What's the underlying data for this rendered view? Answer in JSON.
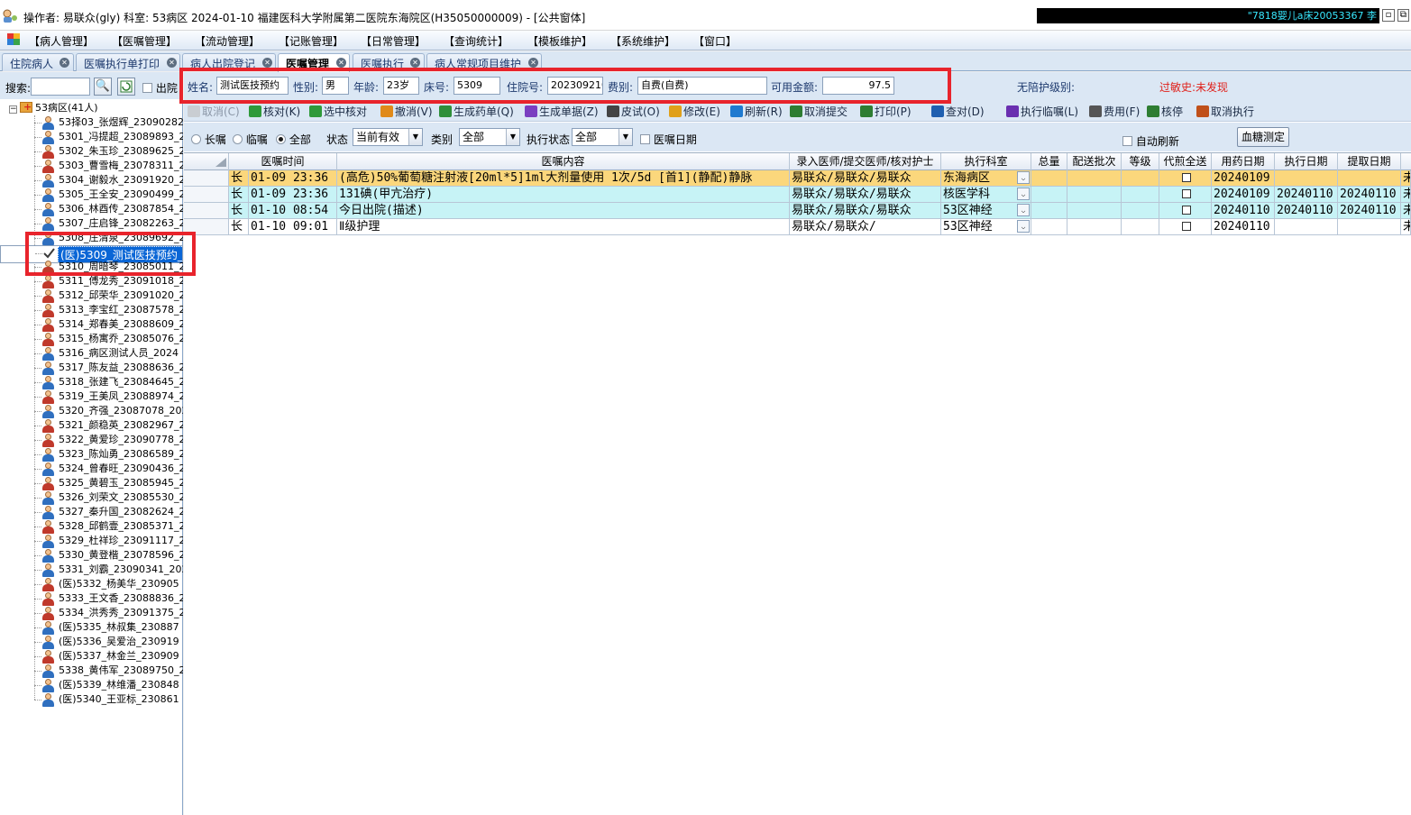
{
  "title": {
    "text": "操作者: 易联众(gly)  科室: 53病区  2024-01-10  福建医科大学附属第二医院东海院区(H35050000009) - [公共窗体]",
    "marquee": "\"7818婴儿a床20053367 李"
  },
  "menu": [
    "【病人管理】",
    "【医嘱管理】",
    "【流动管理】",
    "【记账管理】",
    "【日常管理】",
    "【查询统计】",
    "【模板维护】",
    "【系统维护】",
    "【窗口】"
  ],
  "tabs": [
    {
      "label": "住院病人",
      "active": false
    },
    {
      "label": "医嘱执行单打印",
      "active": false
    },
    {
      "label": "病人出院登记",
      "active": false
    },
    {
      "label": "医嘱管理",
      "active": true
    },
    {
      "label": "医嘱执行",
      "active": false
    },
    {
      "label": "病人常规项目维护",
      "active": false
    }
  ],
  "search": {
    "label": "搜索:",
    "value": "",
    "discharge_label": "出院"
  },
  "tree": {
    "root": "53病区(41人)",
    "patients": [
      {
        "text": "53择03_张煜辉_23090282",
        "sex": "m"
      },
      {
        "text": "5301_冯提超_23089893_2",
        "sex": "m"
      },
      {
        "text": "5302_朱玉珍_23089625_2",
        "sex": "f"
      },
      {
        "text": "5303_曹雪梅_23078311_2",
        "sex": "f"
      },
      {
        "text": "5304_谢毅水_23091920_2",
        "sex": "m"
      },
      {
        "text": "5305_王全安_23090499_2",
        "sex": "m"
      },
      {
        "text": "5306_林酉传_23087854_2",
        "sex": "m"
      },
      {
        "text": "5307_庄启锋_23082263_2",
        "sex": "m"
      },
      {
        "text": "5308_庄清泉_23089692_2",
        "sex": "m"
      },
      {
        "text": "(医)5309_测试医技预约_",
        "sex": "check",
        "selected": true
      },
      {
        "text": "5310_周暗琴_23085011_2",
        "sex": "f"
      },
      {
        "text": "5311_傅龙秀_23091018_2",
        "sex": "f"
      },
      {
        "text": "5312_邱荣华_23091020_2",
        "sex": "f"
      },
      {
        "text": "5313_李宝红_23087578_2",
        "sex": "f"
      },
      {
        "text": "5314_郑春美_23088609_2",
        "sex": "f"
      },
      {
        "text": "5315_杨寓乔_23085076_2",
        "sex": "f"
      },
      {
        "text": "5316_病区测试人员_2024",
        "sex": "m"
      },
      {
        "text": "5317_陈友益_23088636_2",
        "sex": "m"
      },
      {
        "text": "5318_张建飞_23084645_2",
        "sex": "m"
      },
      {
        "text": "5319_王美凤_23088974_2",
        "sex": "f"
      },
      {
        "text": "5320_齐强_23087078_202",
        "sex": "m"
      },
      {
        "text": "5321_颜稳英_23082967_2",
        "sex": "f"
      },
      {
        "text": "5322_黄爱珍_23090778_2",
        "sex": "f"
      },
      {
        "text": "5323_陈灿勇_23086589_2",
        "sex": "m"
      },
      {
        "text": "5324_曾春旺_23090436_2",
        "sex": "m"
      },
      {
        "text": "5325_黄碧玉_23085945_2",
        "sex": "f"
      },
      {
        "text": "5326_刘荣文_23085530_2",
        "sex": "m"
      },
      {
        "text": "5327_秦升国_23082624_2",
        "sex": "m"
      },
      {
        "text": "5328_邱鹤壹_23085371_2",
        "sex": "f"
      },
      {
        "text": "5329_杜祥珍_23091117_2",
        "sex": "m"
      },
      {
        "text": "5330_黄登楷_23078596_2",
        "sex": "m"
      },
      {
        "text": "5331_刘霸_23090341_202",
        "sex": "m"
      },
      {
        "text": "(医)5332_杨美华_230905",
        "sex": "f"
      },
      {
        "text": "5333_王文香_23088836_2",
        "sex": "f"
      },
      {
        "text": "5334_洪秀秀_23091375_2",
        "sex": "f"
      },
      {
        "text": "(医)5335_林叔集_230887",
        "sex": "m"
      },
      {
        "text": "(医)5336_吴爱治_230919",
        "sex": "m"
      },
      {
        "text": "(医)5337_林金兰_230909",
        "sex": "f"
      },
      {
        "text": "5338_黄伟军_23089750_2",
        "sex": "m"
      },
      {
        "text": "(医)5339_林维潘_230848",
        "sex": "m"
      },
      {
        "text": "(医)5340_王亚标_230861",
        "sex": "m"
      }
    ]
  },
  "patient_info": {
    "name_label": "姓名:",
    "name": "测试医技预约",
    "sex_label": "性别:",
    "sex": "男",
    "age_label": "年龄:",
    "age": "23岁",
    "bed_label": "床号:",
    "bed": "5309",
    "admission_label": "住院号:",
    "admission": "2023092103",
    "fee_label": "费别:",
    "fee": "自费(自费)",
    "balance_label": "可用金额:",
    "balance": "97.5",
    "nursing_label": "无陪护级别:",
    "allergy_label": "过敏史:未发现",
    "allergy_color": "#e0201a"
  },
  "toolbar": [
    {
      "label": "取消(C)",
      "disabled": true,
      "icon": "cancel-icon"
    },
    {
      "label": "核对(K)",
      "disabled": false,
      "icon": "check-icon"
    },
    {
      "label": "选中核对",
      "disabled": false,
      "icon": "check-selected-icon"
    },
    {
      "label": "撤消(V)",
      "disabled": false,
      "icon": "undo-icon"
    },
    {
      "label": "生成药单(Q)",
      "disabled": false,
      "icon": "pills-icon"
    },
    {
      "label": "生成单据(Z)",
      "disabled": false,
      "icon": "gear-icon"
    },
    {
      "label": "皮试(O)",
      "disabled": false,
      "icon": "syringe-icon"
    },
    {
      "label": "修改(E)",
      "disabled": false,
      "icon": "edit-icon"
    },
    {
      "label": "刷新(R)",
      "disabled": false,
      "icon": "refresh-icon"
    },
    {
      "label": "取消提交",
      "disabled": false,
      "icon": "cancel-submit-icon"
    },
    {
      "label": "打印(P)",
      "disabled": false,
      "icon": "printer-icon"
    },
    {
      "label": "查对(D)",
      "disabled": false,
      "icon": "search-icon"
    },
    {
      "label": "执行临嘱(L)",
      "disabled": false,
      "icon": "execute-icon"
    },
    {
      "label": "费用(F)",
      "disabled": false,
      "icon": "calculator-icon"
    },
    {
      "label": "核停",
      "disabled": false,
      "icon": "stop-check-icon"
    },
    {
      "label": "取消执行",
      "disabled": false,
      "icon": "cancel-exec-icon"
    }
  ],
  "filters": {
    "radio_long": "长嘱",
    "radio_temp": "临嘱",
    "radio_all": "全部",
    "status_label": "状态",
    "status_value": "当前有效",
    "type_label": "类别",
    "type_value": "全部",
    "exec_label": "执行状态",
    "exec_value": "全部",
    "date_label": "医嘱日期",
    "auto_refresh": "自动刷新",
    "blood_sugar": "血糖测定"
  },
  "grid": {
    "headers": [
      "",
      "医嘱时间",
      "医嘱内容",
      "录入医师/提交医师/核对护士",
      "执行科室",
      "总量",
      "配送批次",
      "等级",
      "代煎全送",
      "用药日期",
      "执行日期",
      "提取日期"
    ],
    "rows": [
      {
        "type": "长",
        "time": "01-09 23:36",
        "content": "(高危)50%葡萄糖注射液[20ml*5]1ml大剂量使用  1次/5d [首1](静配)静脉",
        "doctor": "易联众/易联众/易联众",
        "dept": "东海病区",
        "use_date": "20240109",
        "exec_date": "",
        "fetch_date": "",
        "tail": "未",
        "bg": "#fbd77c"
      },
      {
        "type": "长",
        "time": "01-09 23:36",
        "content": "131碘(甲亢治疗)",
        "doctor": "易联众/易联众/易联众",
        "dept": "核医学科",
        "use_date": "20240109",
        "exec_date": "20240110",
        "fetch_date": "20240110",
        "tail": "未",
        "bg": "#c7f3f6"
      },
      {
        "type": "长",
        "time": "01-10 08:54",
        "content": "今日出院(描述)",
        "doctor": "易联众/易联众/易联众",
        "dept": "53区神经",
        "use_date": "20240110",
        "exec_date": "20240110",
        "fetch_date": "20240110",
        "tail": "未",
        "bg": "#c7f3f6"
      },
      {
        "type": "长",
        "time": "01-10 09:01",
        "content": "Ⅱ级护理",
        "doctor": "易联众/易联众/",
        "dept": "53区神经",
        "use_date": "20240110",
        "exec_date": "",
        "fetch_date": "",
        "tail": "未",
        "bg": "#ffffff"
      }
    ]
  }
}
